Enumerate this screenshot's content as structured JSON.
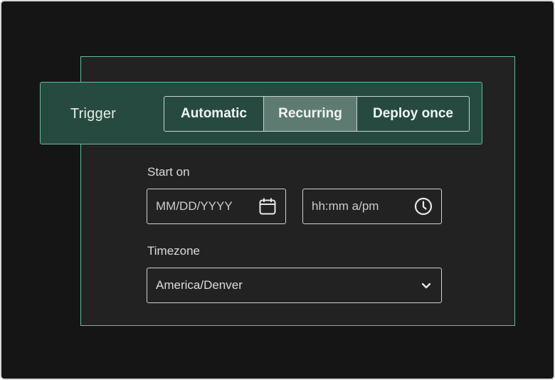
{
  "trigger": {
    "label": "Trigger",
    "options": [
      "Automatic",
      "Recurring",
      "Deploy once"
    ],
    "selected": "Recurring"
  },
  "start_on": {
    "label": "Start on",
    "date_placeholder": "MM/DD/YYYY",
    "time_placeholder": "hh:mm a/pm",
    "date_icon": "calendar-icon",
    "time_icon": "clock-icon"
  },
  "timezone": {
    "label": "Timezone",
    "value": "America/Denver",
    "icon": "chevron-down-icon"
  },
  "colors": {
    "background": "#151515",
    "panel": "#222222",
    "accent_border": "#5fbe9c",
    "trigger_bar": "#274a40",
    "selected_segment": "#5d7b71"
  }
}
